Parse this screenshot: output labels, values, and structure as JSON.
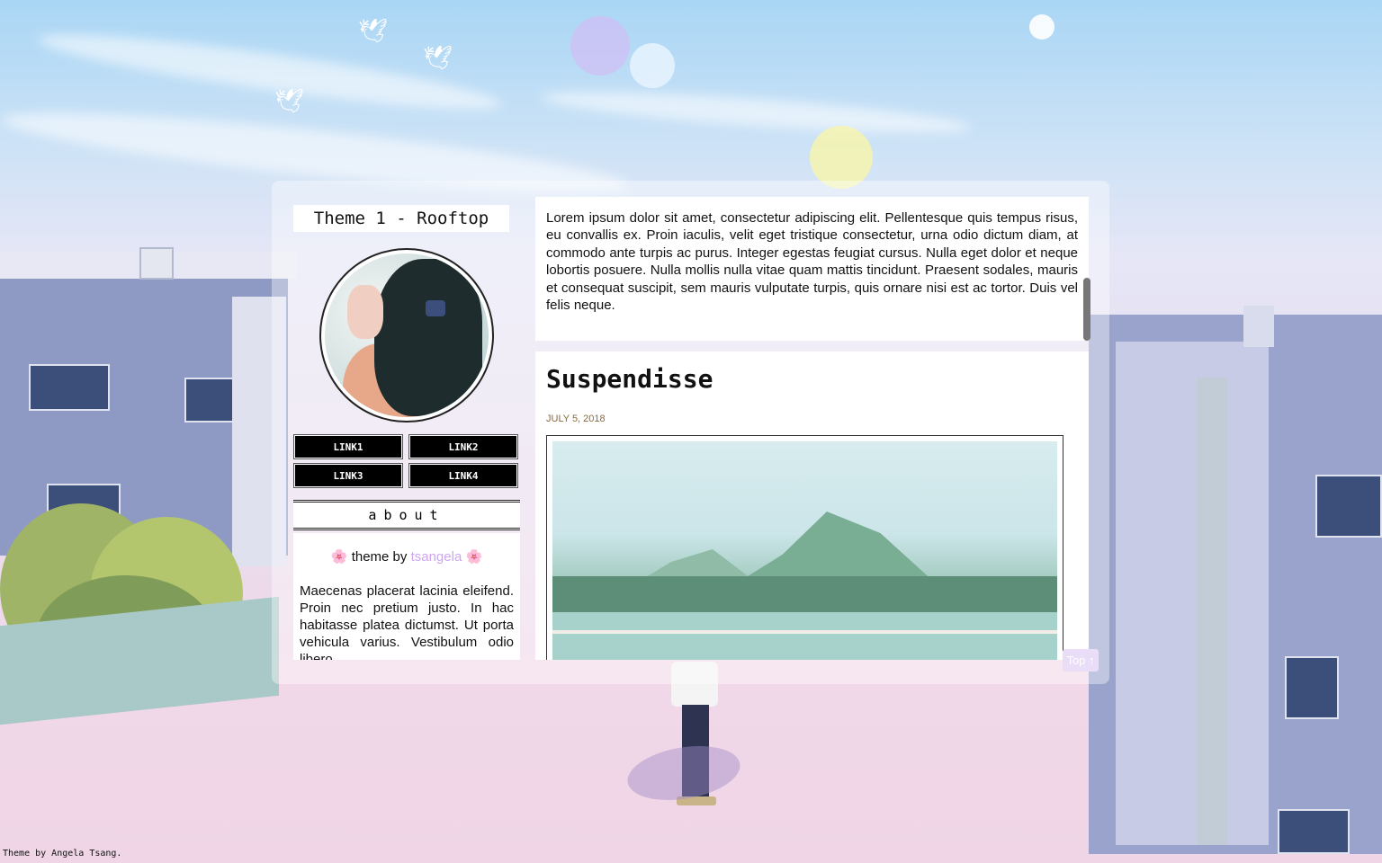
{
  "blog": {
    "title": "Theme 1 - Rooftop"
  },
  "sidebar": {
    "links": [
      "LINK1",
      "LINK2",
      "LINK3",
      "LINK4"
    ],
    "about_heading": "about",
    "credit_prefix": "theme by",
    "credit_author": "tsangela",
    "flower_glyph": "🌸",
    "about_text": "Maecenas placerat lacinia eleifend. Proin nec pretium justo. In hac habitasse platea dictumst. Ut porta vehicula varius. Vestibulum odio libero, ..."
  },
  "posts": [
    {
      "type": "text",
      "body": "Lorem ipsum dolor sit amet, consectetur adipiscing elit. Pellentesque quis tempus risus, eu convallis ex. Proin iaculis, velit eget tristique consectetur, urna odio dictum diam, at commodo ante turpis ac purus. Integer egestas feugiat cursus. Nulla eget dolor et neque lobortis posuere. Nulla mollis nulla vitae quam mattis tincidunt. Praesent sodales, mauris et consequat suscipit, sem mauris vulputate turpis, quis ornare nisi est ac tortor. Duis vel felis neque."
    },
    {
      "type": "photo",
      "title": "Suspendisse",
      "date": "JULY 5, 2018"
    }
  ],
  "top_button": "Top ↑",
  "footer_credit": "Theme by Angela Tsang.",
  "colors": {
    "accent_link": "#cfa6ef",
    "date_color": "#8a6a3c",
    "top_button_bg": "#e9ddf7"
  }
}
